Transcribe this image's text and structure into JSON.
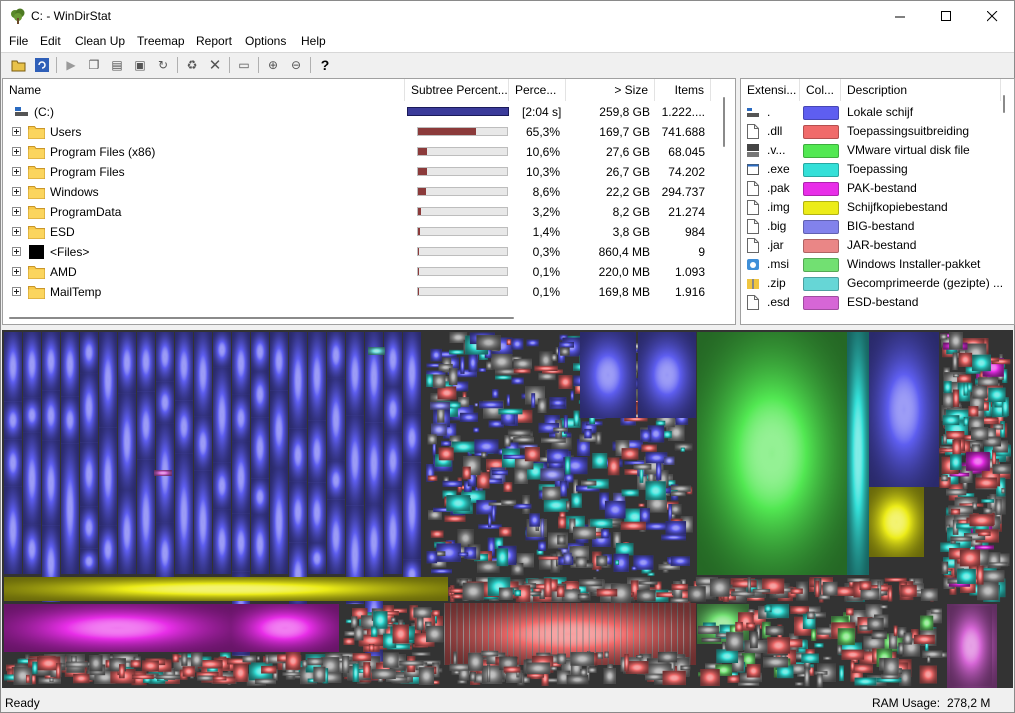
{
  "window": {
    "title": "C: - WinDirStat"
  },
  "menu": [
    "File",
    "Edit",
    "Clean Up",
    "Treemap",
    "Report",
    "Options",
    "Help"
  ],
  "tree": {
    "columns": {
      "name": "Name",
      "subtree": "Subtree Percent...",
      "percent": "Perce...",
      "size": "> Size",
      "items": "Items"
    },
    "root": {
      "name": "(C:)",
      "percent": "[2:04 s]",
      "size": "259,8 GB",
      "items": "1.222....",
      "fill_pct": 100
    },
    "rows": [
      {
        "name": "Users",
        "percent": "65,3%",
        "size": "169,7 GB",
        "items": "741.688",
        "fill_pct": 65.3
      },
      {
        "name": "Program Files (x86)",
        "percent": "10,6%",
        "size": "27,6 GB",
        "items": "68.045",
        "fill_pct": 10.6
      },
      {
        "name": "Program Files",
        "percent": "10,3%",
        "size": "26,7 GB",
        "items": "74.202",
        "fill_pct": 10.3
      },
      {
        "name": "Windows",
        "percent": "8,6%",
        "size": "22,2 GB",
        "items": "294.737",
        "fill_pct": 8.6
      },
      {
        "name": "ProgramData",
        "percent": "3,2%",
        "size": "8,2 GB",
        "items": "21.274",
        "fill_pct": 3.2
      },
      {
        "name": "ESD",
        "percent": "1,4%",
        "size": "3,8 GB",
        "items": "984",
        "fill_pct": 1.4
      },
      {
        "name": "<Files>",
        "percent": "0,3%",
        "size": "860,4 MB",
        "items": "9",
        "fill_pct": 0.3
      },
      {
        "name": "AMD",
        "percent": "0,1%",
        "size": "220,0 MB",
        "items": "1.093",
        "fill_pct": 0.1
      },
      {
        "name": "MailTemp",
        "percent": "0,1%",
        "size": "169,8 MB",
        "items": "1.916",
        "fill_pct": 0.1
      }
    ]
  },
  "extensions": {
    "columns": {
      "ext": "Extensi...",
      "color": "Col...",
      "desc": "Description"
    },
    "rows": [
      {
        "ext": ".",
        "color": "#5e5ef0",
        "desc": "Lokale schijf",
        "icon": "drive-icon"
      },
      {
        "ext": ".dll",
        "color": "#f06a6a",
        "desc": "Toepassingsuitbreiding",
        "icon": "dll-file-icon"
      },
      {
        "ext": ".v...",
        "color": "#52e852",
        "desc": "VMware virtual disk file",
        "icon": "vmdk-file-icon"
      },
      {
        "ext": ".exe",
        "color": "#34e0d8",
        "desc": "Toepassing",
        "icon": "exe-file-icon"
      },
      {
        "ext": ".pak",
        "color": "#e82ee8",
        "desc": "PAK-bestand",
        "icon": "file-icon"
      },
      {
        "ext": ".img",
        "color": "#ecec18",
        "desc": "Schijfkopiebestand",
        "icon": "img-file-icon"
      },
      {
        "ext": ".big",
        "color": "#8282ec",
        "desc": "BIG-bestand",
        "icon": "file-icon"
      },
      {
        "ext": ".jar",
        "color": "#ea8686",
        "desc": "JAR-bestand",
        "icon": "file-icon"
      },
      {
        "ext": ".msi",
        "color": "#72e072",
        "desc": "Windows Installer-pakket",
        "icon": "msi-file-icon"
      },
      {
        "ext": ".zip",
        "color": "#66d6d6",
        "desc": "Gecomprimeerde (gezipte) ...",
        "icon": "zip-file-icon"
      },
      {
        "ext": ".esd",
        "color": "#d666d6",
        "desc": "ESD-bestand",
        "icon": "file-icon"
      }
    ]
  },
  "status": {
    "text": "Ready",
    "ram_label": "RAM Usage:",
    "ram_value": "278,2 M"
  },
  "colors": {
    "root_bar": "#3b3b9a",
    "subtree_bar": "#8b3a3a"
  }
}
